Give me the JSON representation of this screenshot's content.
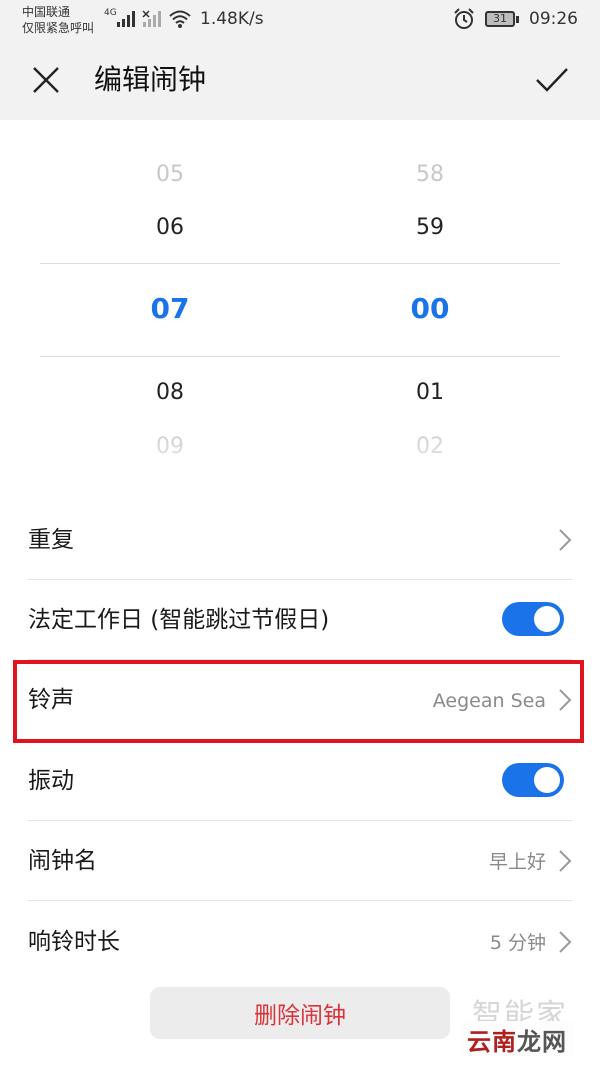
{
  "status_bar": {
    "carrier_line1": "中国联通",
    "carrier_line2": "仅限紧急呼叫",
    "network_type": "4G",
    "net_speed": "1.48K/s",
    "battery": "31",
    "time": "09:26",
    "icons": [
      "signal-icon",
      "wifi-icon",
      "alarm-icon",
      "battery-icon"
    ]
  },
  "header": {
    "title": "编辑闹钟",
    "close_icon": "close-icon",
    "confirm_icon": "checkmark-icon"
  },
  "time_picker": {
    "hours": {
      "far_above": "05",
      "above": "06",
      "selected": "07",
      "below": "08",
      "far_below": "09"
    },
    "minutes": {
      "far_above": "58",
      "above": "59",
      "selected": "00",
      "below": "01",
      "far_below": "02"
    }
  },
  "settings": {
    "repeat": {
      "label": "重复"
    },
    "workday": {
      "label": "法定工作日 (智能跳过节假日)",
      "enabled": true
    },
    "ringtone": {
      "label": "铃声",
      "value": "Aegean Sea"
    },
    "vibrate": {
      "label": "振动",
      "enabled": true
    },
    "alarm_name": {
      "label": "闹钟名",
      "value": "早上好"
    },
    "ring_duration": {
      "label": "响铃时长",
      "value": "5 分钟"
    }
  },
  "delete_button": {
    "label": "删除闹钟"
  },
  "watermark": {
    "top_text": "智能家",
    "bottom_part1": "云南",
    "bottom_part2": "龙网"
  },
  "colors": {
    "accent": "#1a73e8",
    "delete_red": "#d9333a",
    "highlight_red": "#e0141e"
  }
}
